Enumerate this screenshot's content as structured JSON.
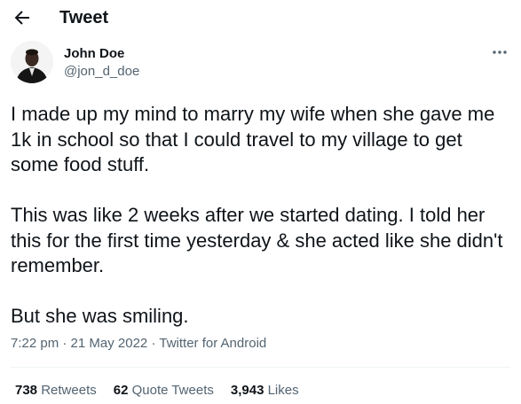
{
  "header": {
    "back_icon": "arrow-left-icon",
    "title": "Tweet"
  },
  "tweet": {
    "author": {
      "name": "John Doe",
      "handle": "@jon_d_doe",
      "avatar": "profile-photo"
    },
    "more_icon": "more-horizontal-icon",
    "paragraphs": [
      "I made up my mind to marry my wife when she gave me 1k in school so that I could travel to my village to get some food stuff.",
      "This was like 2 weeks after we started dating. I told her this for the first time yesterday & she acted like she didn't remember.",
      "But she was smiling."
    ],
    "time": "7:22 pm",
    "date": "21 May 2022",
    "source": "Twitter for Android",
    "separator": "·"
  },
  "stats": {
    "retweets": {
      "count": "738",
      "label": "Retweets"
    },
    "quotes": {
      "count": "62",
      "label": "Quote Tweets"
    },
    "likes": {
      "count": "3,943",
      "label": "Likes"
    }
  },
  "colors": {
    "text": "#0f1419",
    "secondary": "#536471",
    "divider": "#eff3f4"
  }
}
